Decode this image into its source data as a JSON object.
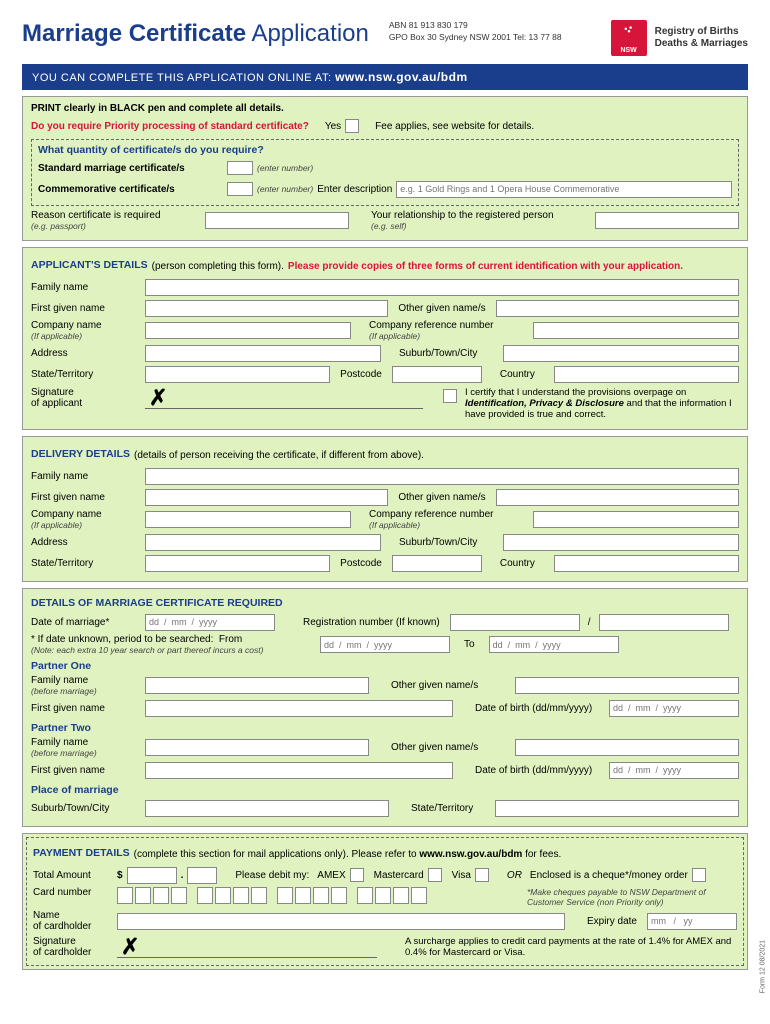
{
  "header": {
    "title_bold": "Marriage Certificate",
    "title_light": "Application",
    "abn_line1": "ABN 81 913 830 179",
    "abn_line2": "GPO Box 30 Sydney NSW 2001 Tel: 13 77 88",
    "nsw": "NSW",
    "registry_l1": "Registry of Births",
    "registry_l2": "Deaths & Marriages"
  },
  "banner": {
    "prefix": "YOU CAN COMPLETE THIS APPLICATION ONLINE AT:",
    "url": "www.nsw.gov.au/bdm"
  },
  "top": {
    "print_instr": "PRINT clearly in BLACK pen and complete all details.",
    "priority_q": "Do you require Priority processing of standard certificate?",
    "yes": "Yes",
    "fee_note": "Fee applies, see website for details.",
    "qty_heading": "What quantity of certificate/s do you require?",
    "std_label": "Standard marriage certificate/s",
    "enter_number": "(enter number)",
    "comm_label": "Commemorative certificate/s",
    "enter_desc": "Enter description",
    "desc_placeholder": "e.g. 1 Gold Rings and 1 Opera House Commemorative",
    "reason_label": "Reason certificate is required",
    "reason_hint": "(e.g. passport)",
    "relationship_label": "Your relationship to the registered person",
    "relationship_hint": "(e.g. self)"
  },
  "applicant": {
    "heading": "APPLICANT'S DETAILS",
    "heading_note": "(person completing this form).",
    "heading_warn": "Please provide copies of three forms of current identification with your application.",
    "family_name": "Family name",
    "first_given": "First given name",
    "other_given": "Other given name/s",
    "company_name": "Company name",
    "if_applicable": "(If applicable)",
    "company_ref": "Company reference number",
    "address": "Address",
    "suburb": "Suburb/Town/City",
    "state": "State/Territory",
    "postcode": "Postcode",
    "country": "Country",
    "signature": "Signature",
    "of_applicant": "of applicant",
    "certify": "I certify that I understand the provisions overpage on ",
    "certify_b": "Identification, Privacy & Disclosure",
    "certify_end": " and that the information I have provided is true and correct."
  },
  "delivery": {
    "heading": "DELIVERY DETAILS",
    "heading_note": "(details of person receiving the certificate, if different from above)."
  },
  "marriage": {
    "heading": "DETAILS OF MARRIAGE CERTIFICATE REQUIRED",
    "date_label": "Date of marriage*",
    "date_ph": "dd  /  mm  /  yyyy",
    "reg_label": "Registration number (If known)",
    "slash": "/",
    "unknown_label": "* If date unknown, period to be searched:",
    "from": "From",
    "to": "To",
    "unknown_note": "(Note: each extra 10 year search or part thereof incurs a cost)",
    "partner1": "Partner One",
    "partner2": "Partner Two",
    "family_name": "Family name",
    "before_marriage": "(before marriage)",
    "first_given": "First given name",
    "other_given": "Other given name/s",
    "dob": "Date of birth (dd/mm/yyyy)",
    "place": "Place of marriage",
    "suburb": "Suburb/Town/City",
    "state": "State/Territory"
  },
  "payment": {
    "heading": "PAYMENT DETAILS",
    "heading_note": "(complete this section for mail applications only). Please refer to ",
    "heading_url": "www.nsw.gov.au/bdm",
    "heading_end": " for fees.",
    "total": "Total Amount",
    "dollar": "$",
    "dot": ".",
    "debit": "Please debit my:",
    "amex": "AMEX",
    "mc": "Mastercard",
    "visa": "Visa",
    "or": "OR",
    "cheque": "Enclosed is a cheque*/money order",
    "cheque_note": "*Make cheques payable to NSW Department of Customer Service (non Priority only)",
    "card_number": "Card number",
    "cardholder": "Name",
    "of_cardholder": "of cardholder",
    "expiry": "Expiry date",
    "expiry_ph": "mm   /   yy",
    "sig": "Signature",
    "sig_of": "of cardholder",
    "surcharge": "A surcharge applies to credit card payments at the rate of 1.4% for AMEX and 0.4% for Mastercard or Visa."
  },
  "footer": "Form 12 08/2021"
}
